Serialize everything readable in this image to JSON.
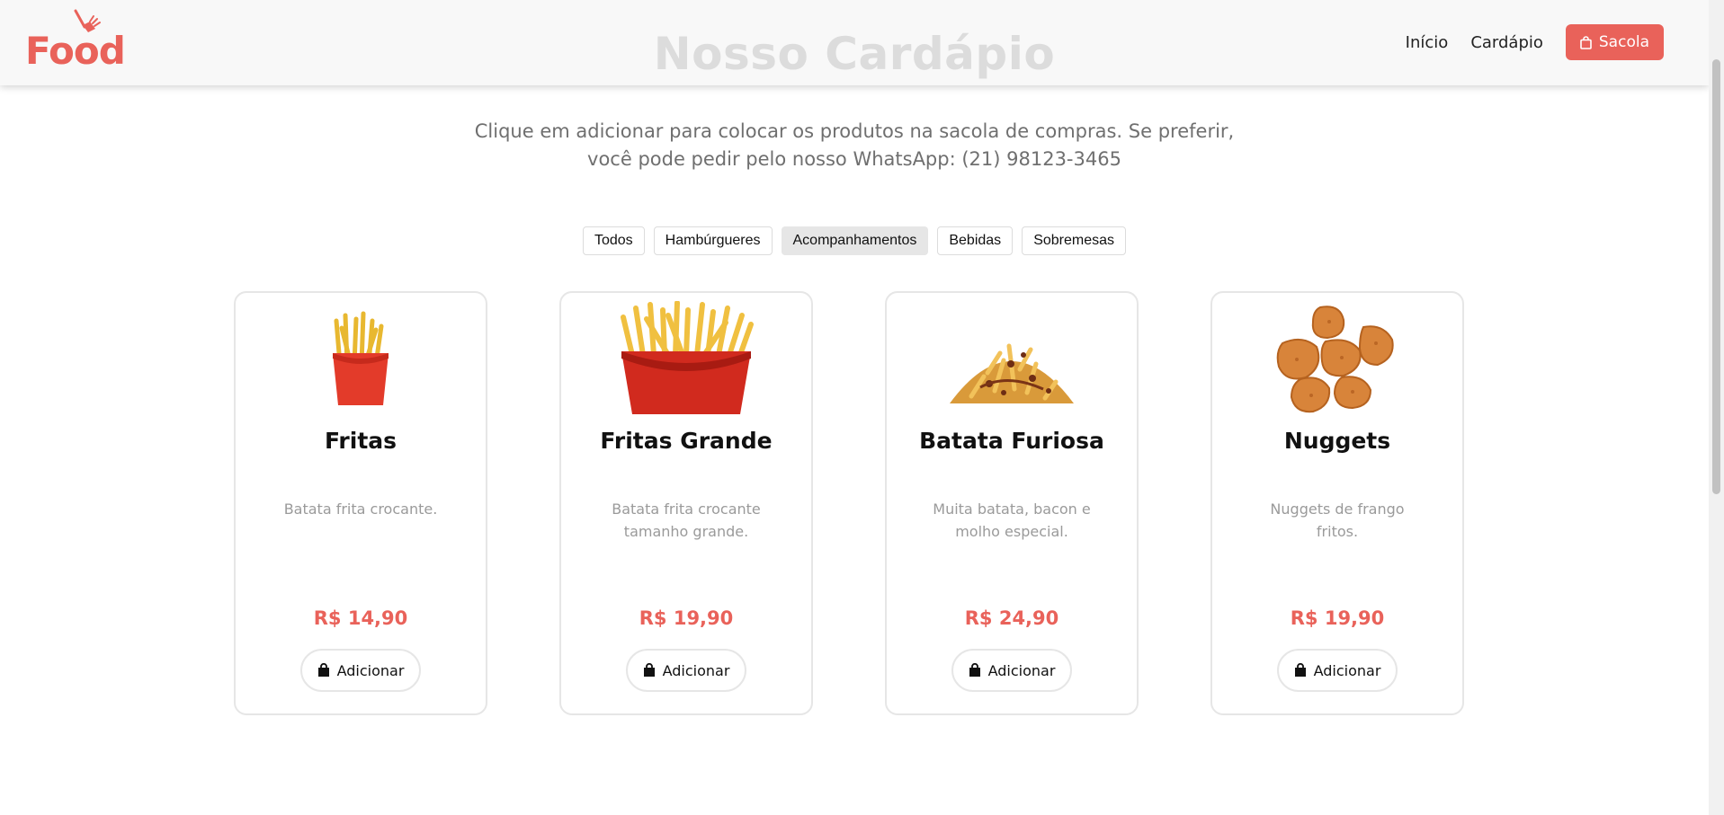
{
  "header": {
    "logo_text": "Food",
    "title": "Nosso Cardápio",
    "nav": {
      "home_label": "Início",
      "menu_label": "Cardápio",
      "bag_label": "Sacola"
    },
    "accent_color": "#e9625a"
  },
  "intro": {
    "line1": "Clique em adicionar para colocar os produtos na sacola de compras. Se preferir,",
    "line2": "você pode pedir pelo nosso WhatsApp: (21) 98123-3465"
  },
  "filters": [
    {
      "label": "Todos",
      "active": false
    },
    {
      "label": "Hambúrgueres",
      "active": false
    },
    {
      "label": "Acompanhamentos",
      "active": true
    },
    {
      "label": "Bebidas",
      "active": false
    },
    {
      "label": "Sobremesas",
      "active": false
    }
  ],
  "products": [
    {
      "name": "Fritas",
      "description": "Batata frita crocante.",
      "price": "R$ 14,90",
      "button_label": "Adicionar",
      "image": "small-fries"
    },
    {
      "name": "Fritas Grande",
      "description": "Batata frita crocante tamanho grande.",
      "price": "R$ 19,90",
      "button_label": "Adicionar",
      "image": "large-fries"
    },
    {
      "name": "Batata Furiosa",
      "description": "Muita batata, bacon e molho especial.",
      "price": "R$ 24,90",
      "button_label": "Adicionar",
      "image": "loaded-fries"
    },
    {
      "name": "Nuggets",
      "description": "Nuggets de frango fritos.",
      "price": "R$ 19,90",
      "button_label": "Adicionar",
      "image": "nuggets"
    }
  ]
}
